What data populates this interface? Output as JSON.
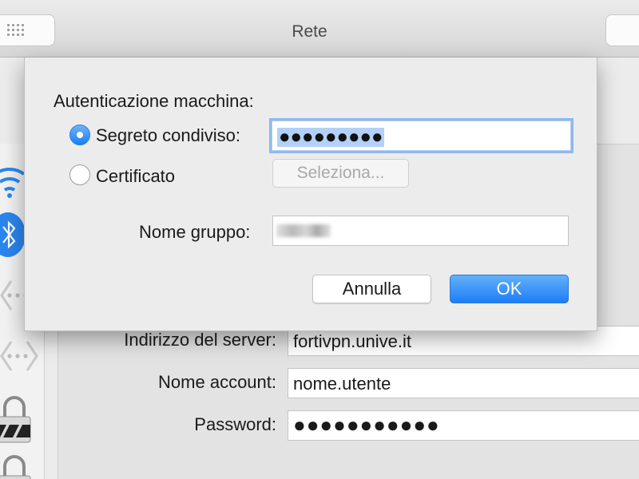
{
  "window": {
    "title": "Rete"
  },
  "toolbar": {
    "grid_icon": "grid-icon"
  },
  "sidebar": {
    "icons": [
      "wifi-icon",
      "bluetooth-icon",
      "network-icon",
      "network-icon",
      "lock-icon",
      "lock-icon"
    ]
  },
  "main": {
    "server_label": "Indirizzo del server:",
    "server_value": "fortivpn.unive.it",
    "account_label": "Nome account:",
    "account_value": "nome.utente",
    "password_label": "Password:",
    "password_value": "●●●●●●●●●●●"
  },
  "sheet": {
    "title": "Autenticazione macchina:",
    "options": {
      "shared_secret_label": "Segreto condiviso:",
      "shared_secret_value": "●●●●●●●●●",
      "certificate_label": "Certificato",
      "select_label": "Seleziona..."
    },
    "group_label": "Nome gruppo:",
    "cancel_label": "Annulla",
    "ok_label": "OK"
  },
  "colors": {
    "accent": "#1d7ef5",
    "focus_ring": "#8fb8ee",
    "selection": "#b3d1f8"
  }
}
